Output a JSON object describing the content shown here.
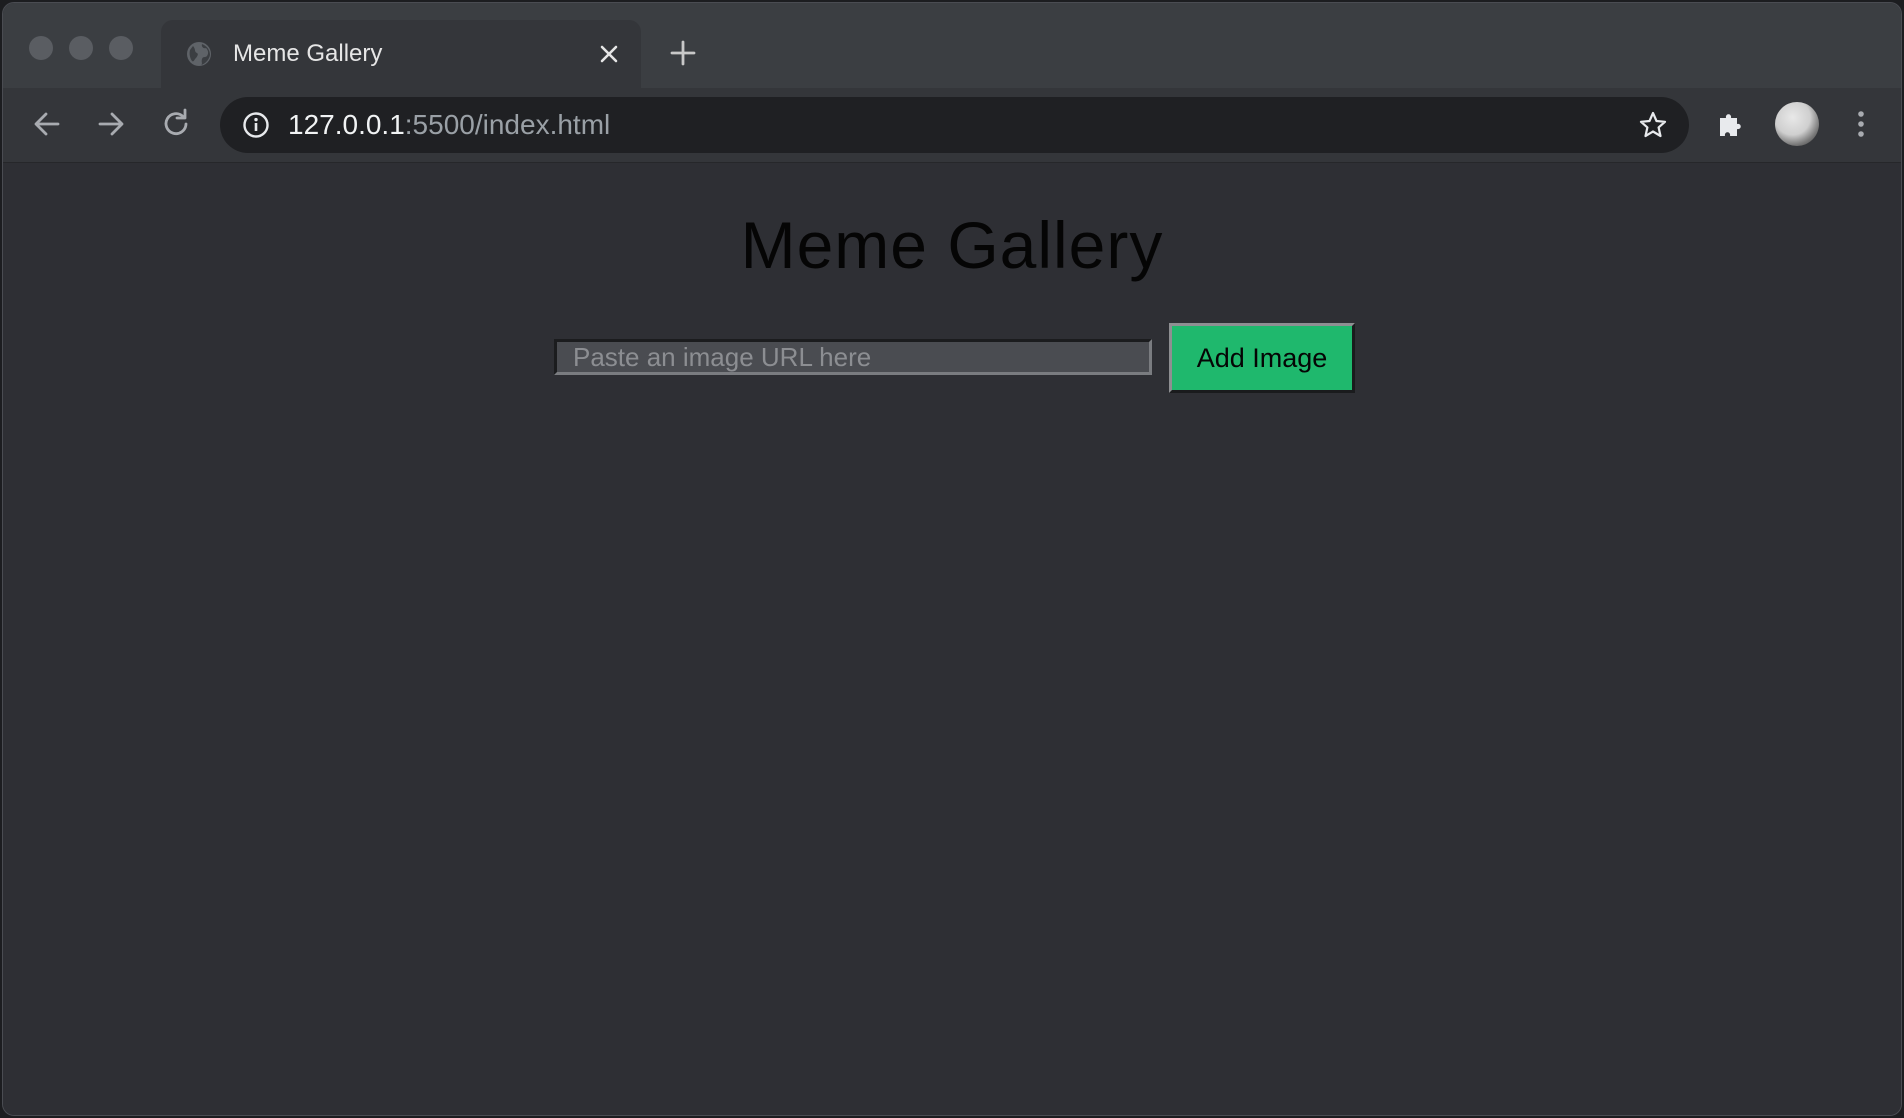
{
  "browser": {
    "tab": {
      "title": "Meme Gallery",
      "favicon": "globe-icon",
      "close_icon": "close-icon"
    },
    "new_tab_icon": "plus-icon",
    "nav": {
      "back_icon": "arrow-left-icon",
      "forward_icon": "arrow-right-icon",
      "reload_icon": "reload-icon"
    },
    "omnibox": {
      "security_icon": "info-icon",
      "url_host": "127.0.0.1",
      "url_rest": ":5500/index.html",
      "bookmark_icon": "star-icon"
    },
    "extensions_icon": "puzzle-icon",
    "profile_icon": "avatar",
    "menu_icon": "kebab-menu-icon"
  },
  "page": {
    "title": "Meme Gallery",
    "url_input": {
      "value": "",
      "placeholder": "Paste an image URL here"
    },
    "add_button_label": "Add Image"
  },
  "colors": {
    "page_background": "#2e2f34",
    "tabstrip": "#3b3e42",
    "toolbar": "#34363a",
    "omnibox": "#1f2023",
    "add_button": "#1fb86d",
    "title_text": "#050505"
  }
}
